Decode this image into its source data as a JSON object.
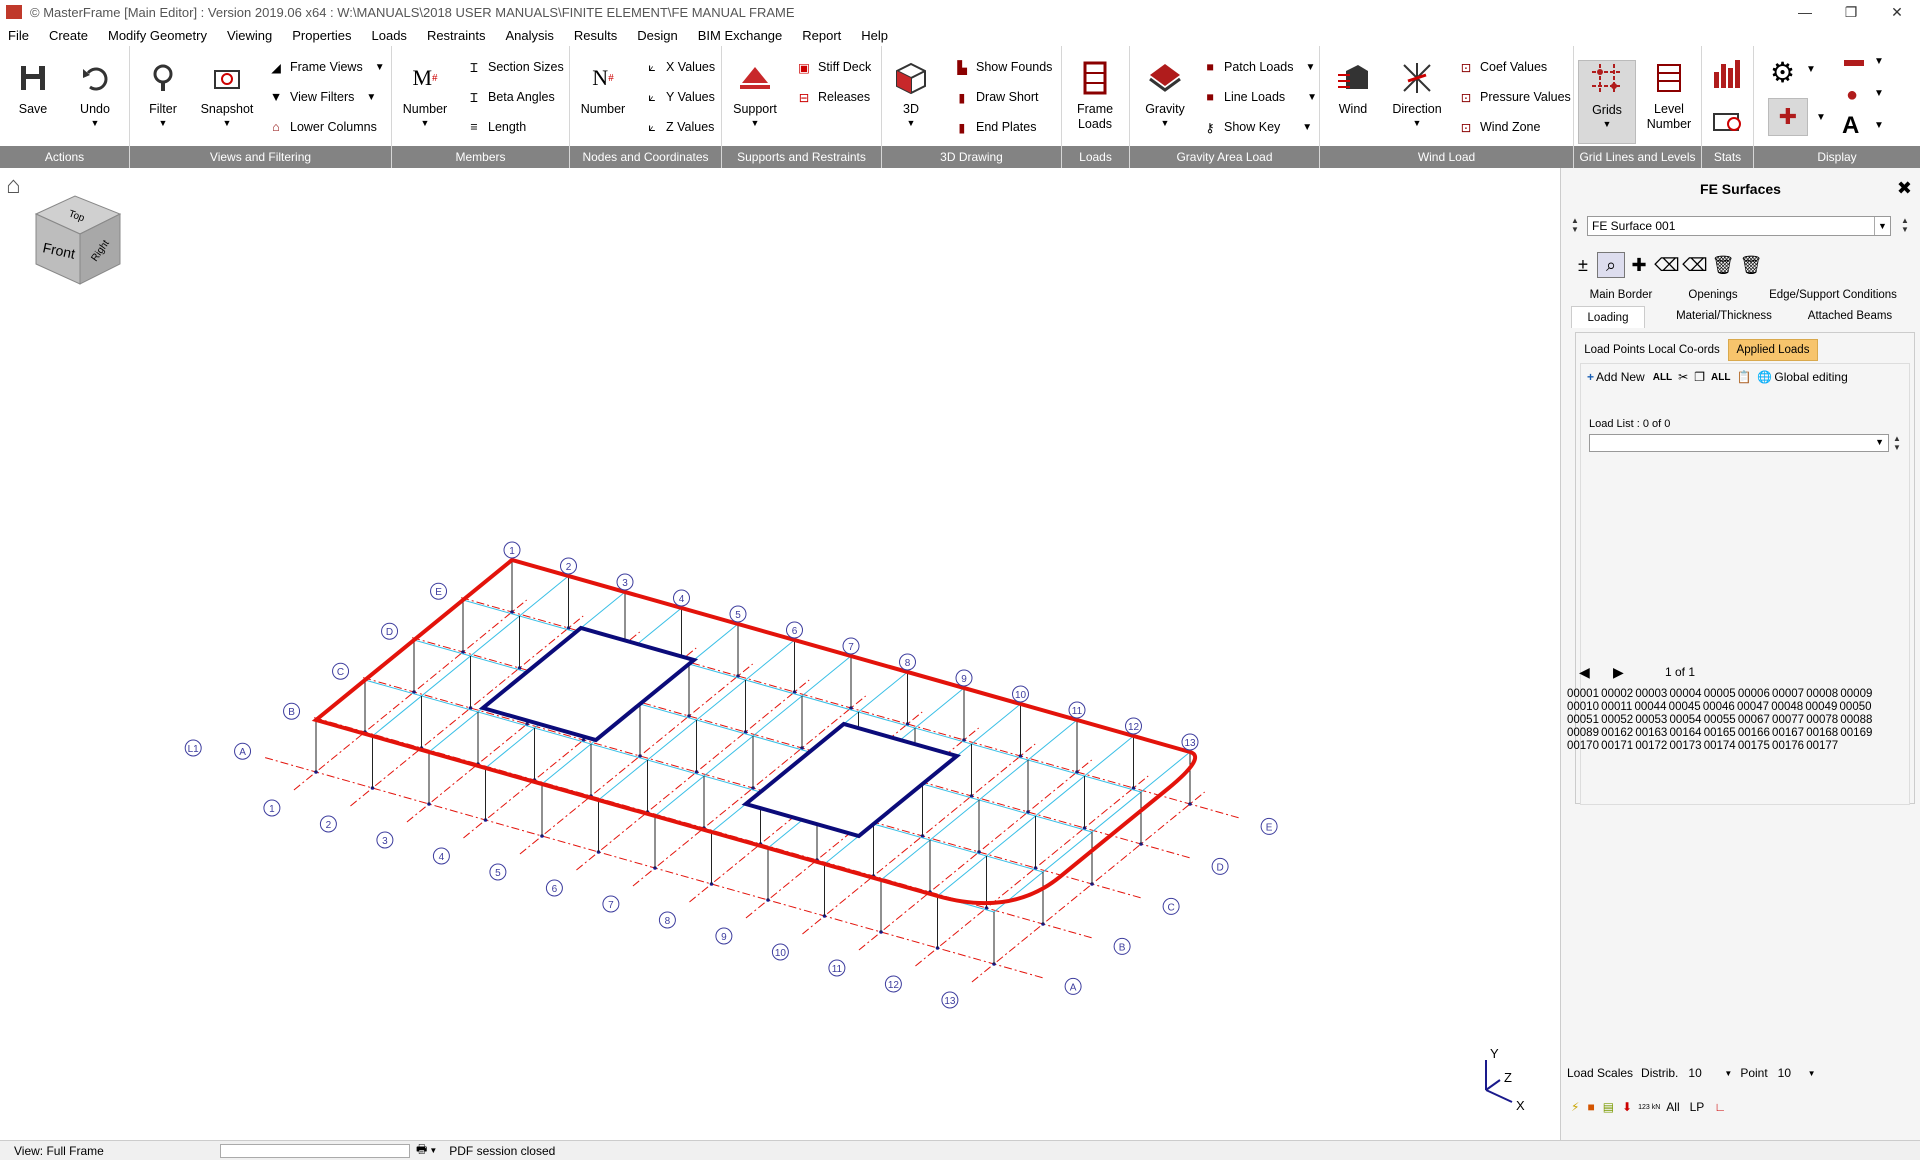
{
  "window": {
    "title": "© MasterFrame [Main Editor] : Version 2019.06 x64 : W:\\MANUALS\\2018 USER MANUALS\\FINITE ELEMENT\\FE MANUAL FRAME",
    "minimize": "—",
    "maximize": "❐",
    "close": "✕"
  },
  "menu": [
    "File",
    "Create",
    "Modify Geometry",
    "Viewing",
    "Properties",
    "Loads",
    "Restraints",
    "Analysis",
    "Results",
    "Design",
    "BIM Exchange",
    "Report",
    "Help"
  ],
  "ribbon": {
    "groups": [
      "Actions",
      "Views and Filtering",
      "Members",
      "Nodes and Coordinates",
      "Supports and Restraints",
      "3D Drawing",
      "Loads",
      "Gravity Area Load",
      "Wind Load",
      "Grid Lines and Levels",
      "Stats",
      "Display"
    ],
    "save": "Save",
    "undo": "Undo",
    "filter": "Filter",
    "snapshot": "Snapshot",
    "frame_views": "Frame Views",
    "view_filters": "View Filters",
    "lower_columns": "Lower Columns",
    "member_number": "Number",
    "section_sizes": "Section Sizes",
    "beta_angles": "Beta Angles",
    "length": "Length",
    "node_number": "Number",
    "x_values": "X Values",
    "y_values": "Y Values",
    "z_values": "Z Values",
    "support": "Support",
    "stiff_deck": "Stiff Deck",
    "releases": "Releases",
    "three_d": "3D",
    "show_founds": "Show Founds",
    "draw_short": "Draw Short",
    "end_plates": "End Plates",
    "frame_loads": "Frame Loads",
    "gravity": "Gravity",
    "patch_loads": "Patch Loads",
    "line_loads": "Line Loads",
    "show_key": "Show Key",
    "wind": "Wind",
    "direction": "Direction",
    "coef_values": "Coef Values",
    "pressure_values": "Pressure Values",
    "wind_zone": "Wind Zone",
    "grids": "Grids",
    "level_number": "Level Number"
  },
  "view": {
    "cube_top": "Top",
    "cube_front": "Front",
    "cube_right": "Right",
    "axis_x": "X",
    "axis_y": "Y",
    "axis_z": "Z",
    "grid_numbers": [
      "1",
      "2",
      "3",
      "4",
      "5",
      "6",
      "7",
      "8",
      "9",
      "10",
      "11",
      "12",
      "13"
    ],
    "grid_letters": [
      "A",
      "B",
      "C",
      "D",
      "E"
    ],
    "level_label": "L1"
  },
  "panel": {
    "title": "FE Surfaces",
    "surface_selected": "FE Surface 001",
    "tabs_row1": [
      "Main Border",
      "Openings",
      "Edge/Support Conditions"
    ],
    "tabs_row2": [
      "Loading",
      "Material/Thickness",
      "Attached Beams"
    ],
    "subtabs": [
      "Load Points Local Co-ords",
      "Applied Loads"
    ],
    "add_new": "Add New",
    "global_editing": "Global editing",
    "load_list": "Load List : 0  of 0",
    "pager": "1 of 1",
    "member_list": "00001 00002 00003 00004 00005 00006 00007 00008 00009 00010 00011 00044 00045 00046 00047 00048 00049 00050 00051 00052 00053 00054 00055 00067 00077 00078 00088 00089 00162 00163 00164 00165 00166 00167 00168 00169 00170 00171 00172 00173 00174 00175 00176 00177",
    "load_scales": "Load Scales",
    "distrib_label": "Distrib.",
    "distrib_value": "10",
    "point_label": "Point",
    "point_value": "10",
    "btm_icons_text": [
      "123 kN",
      "All",
      "LP"
    ]
  },
  "status": {
    "view": "View: Full Frame",
    "pdf": "PDF session closed"
  },
  "colors": {
    "accent_red": "#e3130b",
    "navy": "#0b0b7a",
    "grid_blue": "#3d3d9e",
    "mesh_cyan": "#38bfe6",
    "group_gray": "#838383",
    "tab_orange": "#f7c46c"
  }
}
